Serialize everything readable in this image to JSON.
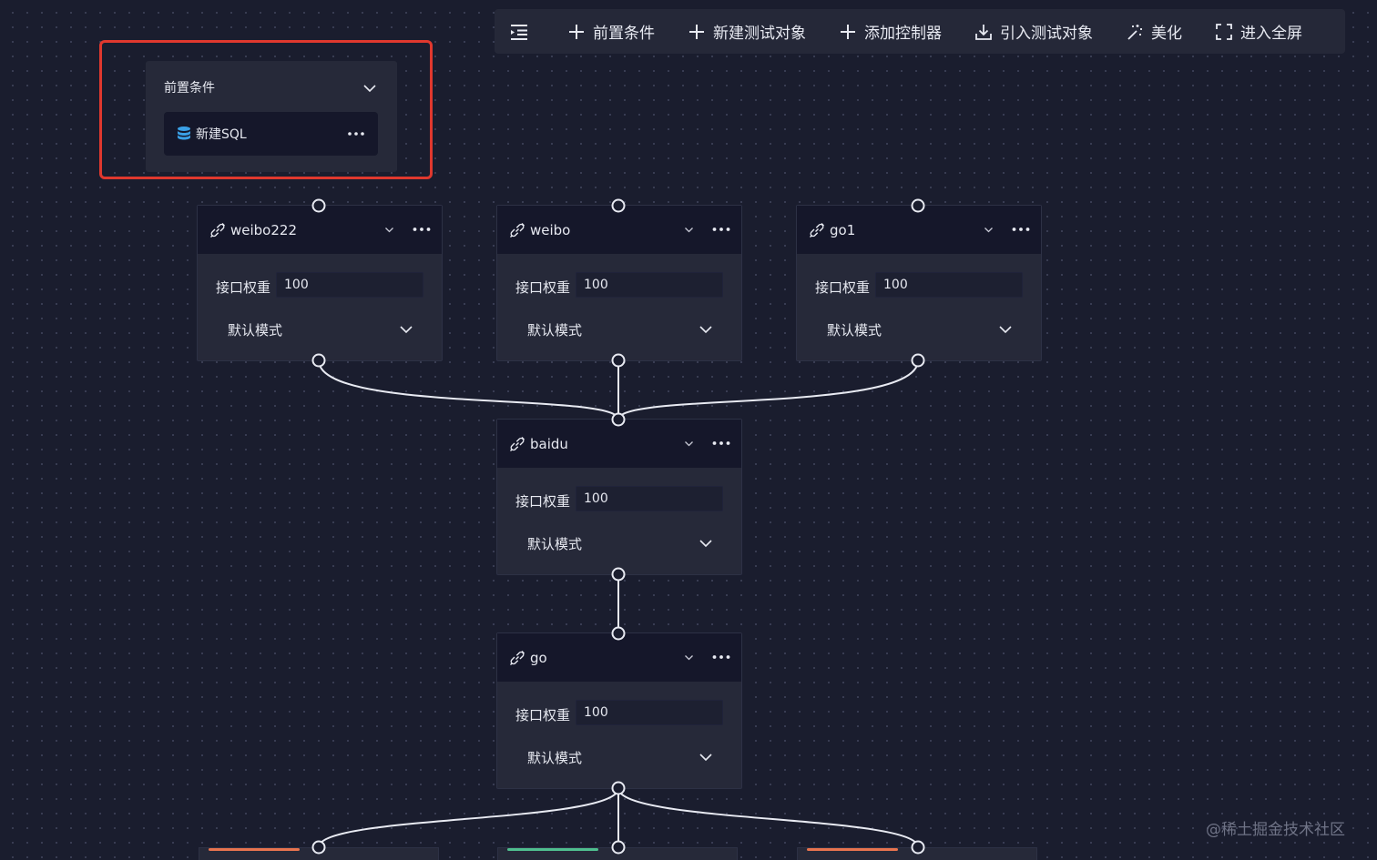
{
  "toolbar": {
    "items": [
      {
        "label": "",
        "icon": "outline-menu-icon"
      },
      {
        "label": "前置条件",
        "icon": "plus-icon"
      },
      {
        "label": "新建测试对象",
        "icon": "plus-icon"
      },
      {
        "label": "添加控制器",
        "icon": "plus-icon"
      },
      {
        "label": "引入测试对象",
        "icon": "download-icon"
      },
      {
        "label": "美化",
        "icon": "magic-wand-icon"
      },
      {
        "label": "进入全屏",
        "icon": "fullscreen-icon"
      }
    ]
  },
  "precondition": {
    "title": "前置条件",
    "item": {
      "label": "新建SQL",
      "icon": "database-icon"
    }
  },
  "nodes": [
    {
      "title": "weibo222",
      "weight_label": "接口权重",
      "weight": "100",
      "mode": "默认模式"
    },
    {
      "title": "weibo",
      "weight_label": "接口权重",
      "weight": "100",
      "mode": "默认模式"
    },
    {
      "title": "go1",
      "weight_label": "接口权重",
      "weight": "100",
      "mode": "默认模式"
    },
    {
      "title": "baidu",
      "weight_label": "接口权重",
      "weight": "100",
      "mode": "默认模式"
    },
    {
      "title": "go",
      "weight_label": "接口权重",
      "weight": "100",
      "mode": "默认模式"
    }
  ],
  "partial_nodes": [
    {
      "accent_color": "#e8744f"
    },
    {
      "accent_color": "#4fbf8f"
    },
    {
      "accent_color": "#e8744f"
    }
  ],
  "colors": {
    "background": "#1a1d2e",
    "panel": "#262939",
    "header": "#15172a",
    "highlight": "#e0382e",
    "wire": "#e8eaf2",
    "database_icon": "#3aa0e6"
  },
  "watermark": "@稀土掘金技术社区"
}
